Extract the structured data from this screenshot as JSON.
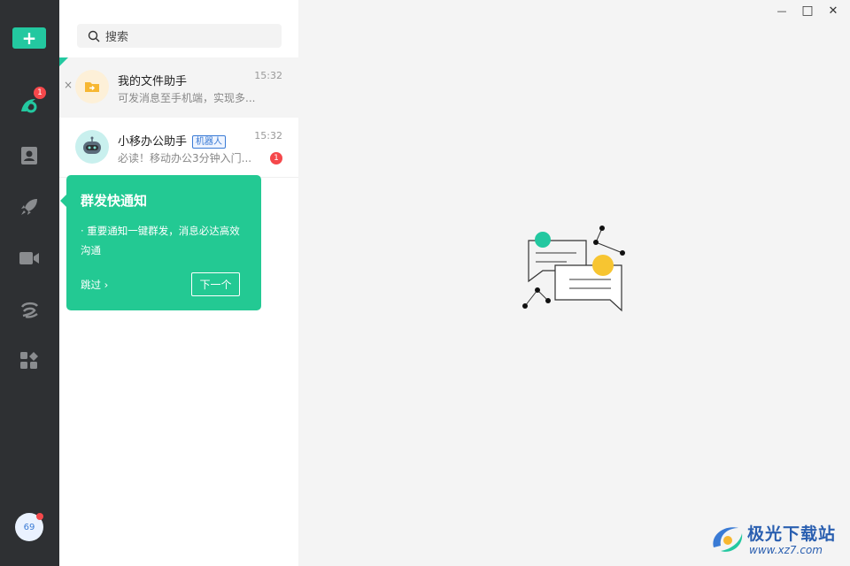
{
  "rail": {
    "add_label": "+",
    "messages_badge": "1",
    "avatar_text": "69",
    "accent_color": "#23c8a0"
  },
  "search": {
    "placeholder": "搜索"
  },
  "conversations": [
    {
      "name": "我的文件助手",
      "time": "15:32",
      "preview": "可发消息至手机端，实现多...",
      "close": "×",
      "active": true
    },
    {
      "name": "小移办公助手",
      "tag": "机器人",
      "time": "15:32",
      "preview": "必读！移动办公3分钟入门...",
      "unread": "1"
    }
  ],
  "tooltip": {
    "title": "群发快通知",
    "description": "· 重要通知一键群发，消息必达高效沟通",
    "skip_label": "跳过 ›",
    "next_label": "下一个"
  },
  "window_controls": {
    "minimize": "—",
    "maximize": "□",
    "close": "✕"
  },
  "watermark": {
    "brand": "极光下载站",
    "url": "www.xz7.com"
  },
  "icons": [
    "plus-icon",
    "messages-icon",
    "contacts-icon",
    "rocket-icon",
    "video-icon",
    "cloud-icon",
    "apps-icon",
    "search-icon",
    "folder-icon",
    "robot-icon",
    "chat-illustration"
  ]
}
